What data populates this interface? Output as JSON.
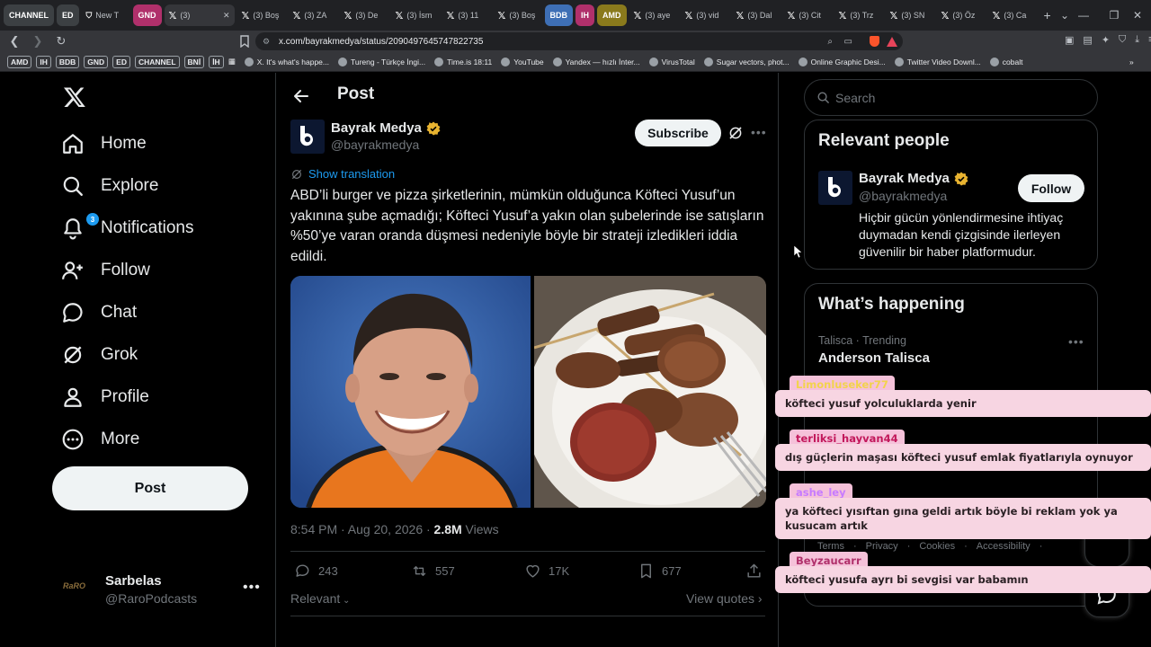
{
  "browser": {
    "tabs": [
      {
        "label": "CHANNEL",
        "kind": "label",
        "color": "#3c4043"
      },
      {
        "label": "ED",
        "kind": "label",
        "color": "#3c4043"
      },
      {
        "label": "New T",
        "kind": "plain"
      },
      {
        "label": "GND",
        "kind": "label",
        "color": "#b0306b"
      },
      {
        "label": "(3)",
        "kind": "active"
      },
      {
        "label": "(3) Boş",
        "kind": "x"
      },
      {
        "label": "(3) ZA",
        "kind": "x"
      },
      {
        "label": "(3) De",
        "kind": "x"
      },
      {
        "label": "(3) İsm",
        "kind": "x"
      },
      {
        "label": "(3) 11",
        "kind": "x"
      },
      {
        "label": "(3) Boş",
        "kind": "x"
      },
      {
        "label": "BDB",
        "kind": "label",
        "color": "#3e6fb5"
      },
      {
        "label": "IH",
        "kind": "label",
        "color": "#b0306b"
      },
      {
        "label": "AMD",
        "kind": "label",
        "color": "#8a7a1c"
      },
      {
        "label": "(3) aye",
        "kind": "x"
      },
      {
        "label": "(3) vid",
        "kind": "x"
      },
      {
        "label": "(3) Dal",
        "kind": "x"
      },
      {
        "label": "(3) Cit",
        "kind": "x"
      },
      {
        "label": "(3) Trz",
        "kind": "x"
      },
      {
        "label": "(3) SN",
        "kind": "x"
      },
      {
        "label": "(3) Öz",
        "kind": "x"
      },
      {
        "label": "(3) Ca",
        "kind": "x"
      }
    ],
    "new_tab": "+",
    "url": "x.com/bayrakmedya/status/2090497645747822735",
    "bookmarks_boxed": [
      "AMD",
      "IH",
      "BDB",
      "GND",
      "ED",
      "CHANNEL",
      "BNİ",
      "İH"
    ],
    "bookmarks": [
      "X. It's what's happe...",
      "Tureng - Türkçe İngi...",
      "Time.is 18:11",
      "YouTube",
      "Yandex — hızlı İnter...",
      "VirusTotal",
      "Sugar vectors, phot...",
      "Online Graphic Desi...",
      "Twitter Video Downl...",
      "cobalt"
    ]
  },
  "nav": {
    "items": [
      {
        "label": "Home",
        "icon": "home-icon"
      },
      {
        "label": "Explore",
        "icon": "search-icon"
      },
      {
        "label": "Notifications",
        "icon": "bell-icon",
        "badge": "3"
      },
      {
        "label": "Follow",
        "icon": "follow-icon"
      },
      {
        "label": "Chat",
        "icon": "chat-icon"
      },
      {
        "label": "Grok",
        "icon": "grok-icon"
      },
      {
        "label": "Profile",
        "icon": "profile-icon"
      },
      {
        "label": "More",
        "icon": "more-circle-icon"
      }
    ],
    "post_label": "Post",
    "account": {
      "name": "Sarbelas",
      "handle": "@RaroPodcasts",
      "avatar_text": "RaRO"
    }
  },
  "post": {
    "header_title": "Post",
    "author_name": "Bayrak Medya",
    "author_handle": "@bayrakmedya",
    "subscribe_label": "Subscribe",
    "show_translation": "Show translation",
    "text": "ABD’li burger ve pizza şirketlerinin, mümkün olduğunca Köfteci Yusuf’un yakınına şube açmadığı; Köfteci Yusuf’a yakın olan şubelerinde ise satışların %50’ye varan oranda düşmesi nedeniyle böyle bir strateji izledikleri iddia edildi.",
    "timestamp": "8:54 PM · Aug 20, 2026 · ",
    "views_count": "2.8M",
    "views_label": " Views",
    "replies": "243",
    "reposts": "557",
    "likes": "17K",
    "bookmarks": "677",
    "relevant_label": "Relevant",
    "view_quotes_label": "View quotes"
  },
  "sidebar": {
    "search_placeholder": "Search",
    "relevant_title": "Relevant people",
    "relevant_person": {
      "name": "Bayrak Medya",
      "handle": "@bayrakmedya",
      "follow_label": "Follow",
      "bio": "Hiçbir gücün yönlendirmesine ihtiyaç duymadan kendi çizgisinde ilerleyen güvenilir bir haber platformudur."
    },
    "happening_title": "What’s happening",
    "trend": {
      "meta": "Talisca · Trending",
      "name": "Anderson Talisca"
    },
    "footer_links": [
      "Terms",
      "·",
      "Privacy",
      "·",
      "Cookies",
      "·",
      "Accessibility",
      "·"
    ]
  },
  "chat_overlay": [
    {
      "user": "Limonluseker77",
      "user_color": "#f2d34b",
      "message": "köfteci yusuf yolculuklarda yenir"
    },
    {
      "user": "terliksi_hayvan44",
      "user_color": "#c2185b",
      "message": "dış güçlerin maşası köfteci yusuf emlak fiyatlarıyla oynuyor"
    },
    {
      "user": "ashe_ley",
      "user_color": "#c77bff",
      "message": "ya köfteci yısıftan gına geldi artık böyle bi reklam yok ya kusucam artık"
    },
    {
      "user": "Beyzaucarr",
      "user_color": "#b0306b",
      "message": "köfteci yusufa ayrı bi sevgisi var babamın"
    }
  ],
  "colors": {
    "accent": "#1d9bf0",
    "verified": "#e8b330",
    "chat_bg": "#f7d5e2"
  }
}
